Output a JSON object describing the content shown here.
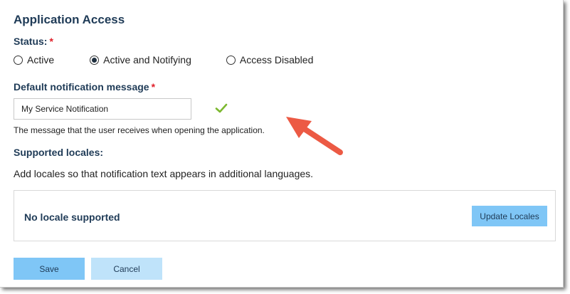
{
  "section": {
    "title": "Application Access"
  },
  "status": {
    "label": "Status:",
    "required_mark": "*",
    "options": [
      {
        "label": "Active",
        "checked": false
      },
      {
        "label": "Active and Notifying",
        "checked": true
      },
      {
        "label": "Access Disabled",
        "checked": false
      }
    ]
  },
  "notification": {
    "label": "Default notification message",
    "required_mark": "*",
    "value": "My Service Notification",
    "helper": "The message that the user receives when opening the application.",
    "valid_icon": "check-icon"
  },
  "locales": {
    "label": "Supported locales:",
    "description": "Add locales so that notification text appears in additional languages.",
    "empty_text": "No locale supported",
    "update_label": "Update Locales"
  },
  "actions": {
    "save_label": "Save",
    "cancel_label": "Cancel"
  },
  "colors": {
    "heading": "#1f3b57",
    "required": "#e0202a",
    "primary_button": "#7fc6f6",
    "secondary_button": "#bfe3fa",
    "check": "#7cb82f",
    "arrow": "#ec5a44"
  }
}
